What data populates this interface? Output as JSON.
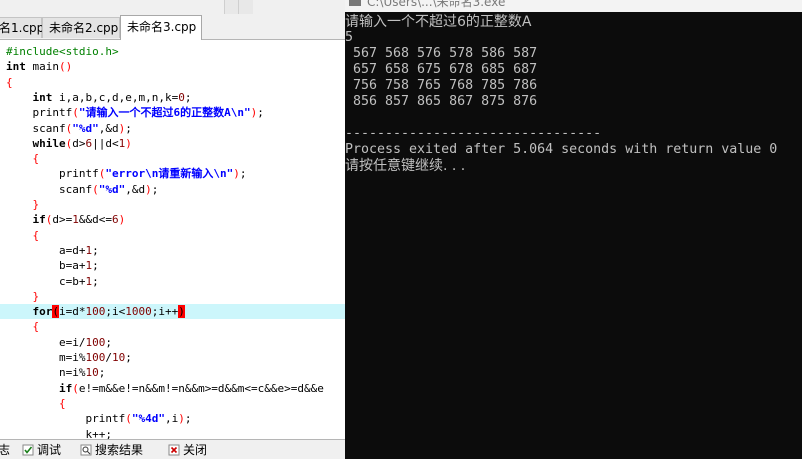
{
  "ide": {
    "tabs": [
      {
        "label": "名1.cpp",
        "active": false
      },
      {
        "label": "未命名2.cpp",
        "active": false
      },
      {
        "label": "未命名3.cpp",
        "active": true
      }
    ],
    "code_lines": [
      [
        [
          "pp",
          "#include<stdio.h>"
        ]
      ],
      [
        [
          "kw",
          "int"
        ],
        [
          "",
          "&#32;main"
        ],
        [
          "br",
          "()"
        ]
      ],
      [
        [
          "br",
          "{"
        ]
      ],
      [
        [
          "",
          "    "
        ],
        [
          "kw",
          "int"
        ],
        [
          "",
          "&#32;i,a,b,c,d,e,m,n,k="
        ],
        [
          "num",
          "0"
        ],
        [
          "",
          ";"
        ]
      ],
      [
        [
          "",
          "    printf"
        ],
        [
          "br",
          "("
        ],
        [
          "str",
          "\"请输入一个不超过6的正整数A\\n\""
        ],
        [
          "br",
          ")"
        ],
        [
          "",
          ";"
        ]
      ],
      [
        [
          "",
          "    scanf"
        ],
        [
          "br",
          "("
        ],
        [
          "str",
          "\"%d\""
        ],
        [
          "",
          ",&d"
        ],
        [
          "br",
          ")"
        ],
        [
          "",
          ";"
        ]
      ],
      [
        [
          "",
          "    "
        ],
        [
          "kw",
          "while"
        ],
        [
          "br",
          "("
        ],
        [
          "",
          "d>"
        ],
        [
          "num",
          "6"
        ],
        [
          "",
          "||d<"
        ],
        [
          "num",
          "1"
        ],
        [
          "br",
          ")"
        ]
      ],
      [
        [
          "",
          "    "
        ],
        [
          "br",
          "{"
        ]
      ],
      [
        [
          "",
          "        printf"
        ],
        [
          "br",
          "("
        ],
        [
          "str",
          "\"error\\n请重新输入\\n\""
        ],
        [
          "br",
          ")"
        ],
        [
          "",
          ";"
        ]
      ],
      [
        [
          "",
          "        scanf"
        ],
        [
          "br",
          "("
        ],
        [
          "str",
          "\"%d\""
        ],
        [
          "",
          ",&d"
        ],
        [
          "br",
          ")"
        ],
        [
          "",
          ";"
        ]
      ],
      [
        [
          "",
          "    "
        ],
        [
          "br",
          "}"
        ]
      ],
      [
        [
          "",
          "    "
        ],
        [
          "kw",
          "if"
        ],
        [
          "br",
          "("
        ],
        [
          "",
          "d>="
        ],
        [
          "num",
          "1"
        ],
        [
          "",
          "&&d<="
        ],
        [
          "num",
          "6"
        ],
        [
          "br",
          ")"
        ]
      ],
      [
        [
          "",
          "    "
        ],
        [
          "br",
          "{"
        ]
      ],
      [
        [
          "",
          "        a=d+"
        ],
        [
          "num",
          "1"
        ],
        [
          "",
          ";"
        ]
      ],
      [
        [
          "",
          "        b=a+"
        ],
        [
          "num",
          "1"
        ],
        [
          "",
          ";"
        ]
      ],
      [
        [
          "",
          "        c=b+"
        ],
        [
          "num",
          "1"
        ],
        [
          "",
          ";"
        ]
      ],
      [
        [
          "",
          "    "
        ],
        [
          "br",
          "}"
        ]
      ],
      [
        [
          "",
          "    "
        ],
        [
          "kw",
          "for"
        ],
        [
          "brm",
          "("
        ],
        [
          "",
          "i=d*"
        ],
        [
          "num",
          "100"
        ],
        [
          "",
          ";i<"
        ],
        [
          "num",
          "1000"
        ],
        [
          "",
          ";i++"
        ],
        [
          "brm",
          ")"
        ]
      ],
      [
        [
          "",
          "    "
        ],
        [
          "br",
          "{"
        ]
      ],
      [
        [
          "",
          "        e=i/"
        ],
        [
          "num",
          "100"
        ],
        [
          "",
          ";"
        ]
      ],
      [
        [
          "",
          "        m=i%"
        ],
        [
          "num",
          "100"
        ],
        [
          "",
          "/"
        ],
        [
          "num",
          "10"
        ],
        [
          "",
          ";"
        ]
      ],
      [
        [
          "",
          "        n=i%"
        ],
        [
          "num",
          "10"
        ],
        [
          "",
          ";"
        ]
      ],
      [
        [
          "",
          "        "
        ],
        [
          "kw",
          "if"
        ],
        [
          "br",
          "("
        ],
        [
          "",
          "e!=m&&e!=n&&m!=n&&m>=d&&m<=c&&e>=d&&e"
        ]
      ],
      [
        [
          "",
          "        "
        ],
        [
          "br",
          "{"
        ]
      ],
      [
        [
          "",
          "            printf"
        ],
        [
          "br",
          "("
        ],
        [
          "str",
          "\"%4d\""
        ],
        [
          "",
          ",i"
        ],
        [
          "br",
          ")"
        ],
        [
          "",
          ";"
        ]
      ],
      [
        [
          "",
          "            k++;"
        ]
      ]
    ],
    "highlight_line": 17,
    "bottom_tabs": [
      {
        "label": "志",
        "icon": "none"
      },
      {
        "label": "调试",
        "icon": "check-icon"
      },
      {
        "label": "搜索结果",
        "icon": "search-results-icon"
      },
      {
        "label": "关闭",
        "icon": "close-icon"
      }
    ]
  },
  "console": {
    "title": "C:\\Users\\...\\未命名3.exe",
    "lines": [
      {
        "text": "请输入一个不超过6的正整数A",
        "cjk": true
      },
      {
        "text": "5",
        "cjk": false
      },
      {
        "text": " 567 568 576 578 586 587",
        "cjk": false
      },
      {
        "text": " 657 658 675 678 685 687",
        "cjk": false
      },
      {
        "text": " 756 758 765 768 785 786",
        "cjk": false
      },
      {
        "text": " 856 857 865 867 875 876",
        "cjk": false
      },
      {
        "text": "",
        "cjk": false
      },
      {
        "text": "--------------------------------",
        "cjk": false
      },
      {
        "text": "Process exited after 5.064 seconds with return value 0",
        "cjk": false
      },
      {
        "text": "请按任意键继续. . .",
        "cjk": true
      }
    ]
  },
  "colors": {
    "console_bg": "#0c0c0c",
    "console_fg": "#c0c0c0",
    "code_highlight": "#ccf6fb",
    "keyword": "#000000",
    "string": "#0000ff",
    "number": "#800000",
    "bracket": "#ff0000",
    "preprocessor": "#008000"
  }
}
